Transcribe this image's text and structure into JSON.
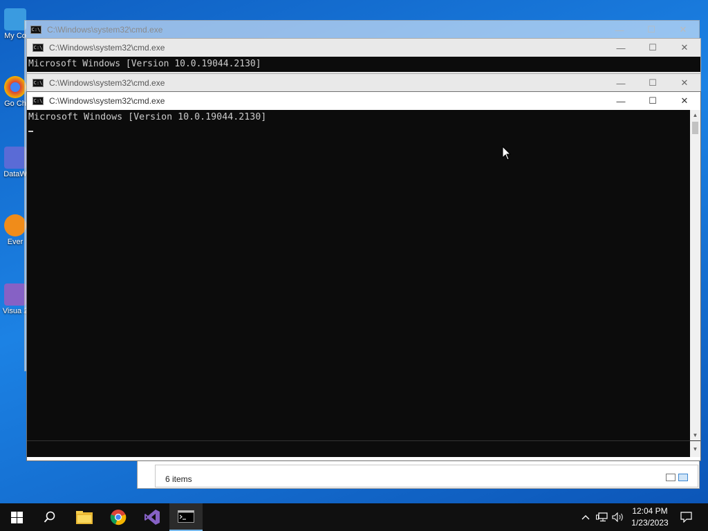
{
  "desktop": {
    "icons": [
      {
        "label": "My Co",
        "color": "#3a9be0"
      },
      {
        "label": "Go Ch",
        "color": "#db4437"
      },
      {
        "label": "DataW",
        "color": "#5a6bd6"
      },
      {
        "label": "Ever",
        "color": "#f08c1a"
      },
      {
        "label": "Visua 2",
        "color": "#8661c5"
      }
    ]
  },
  "windows": {
    "back_title": "C:\\Windows\\system32\\cmd.exe",
    "mid1_title": "C:\\Windows\\system32\\cmd.exe",
    "mid1_line": "Microsoft Windows [Version 10.0.19044.2130]",
    "mid2_title": "C:\\Windows\\system32\\cmd.exe",
    "main_title": "C:\\Windows\\system32\\cmd.exe",
    "main_line1": "Microsoft Windows [Version 10.0.19044.2130]",
    "controls": {
      "minimize": "—",
      "maximize": "☐",
      "close": "✕"
    }
  },
  "explorer": {
    "status_text": "6 items",
    "partial_text": "6 i"
  },
  "taskbar": {
    "time": "12:04 PM",
    "date": "1/23/2023",
    "apps": [
      "start-icon",
      "search-icon",
      "file-explorer-icon",
      "chrome-icon",
      "visual-studio-icon",
      "cmd-icon"
    ],
    "accent": "#76b9ed"
  }
}
